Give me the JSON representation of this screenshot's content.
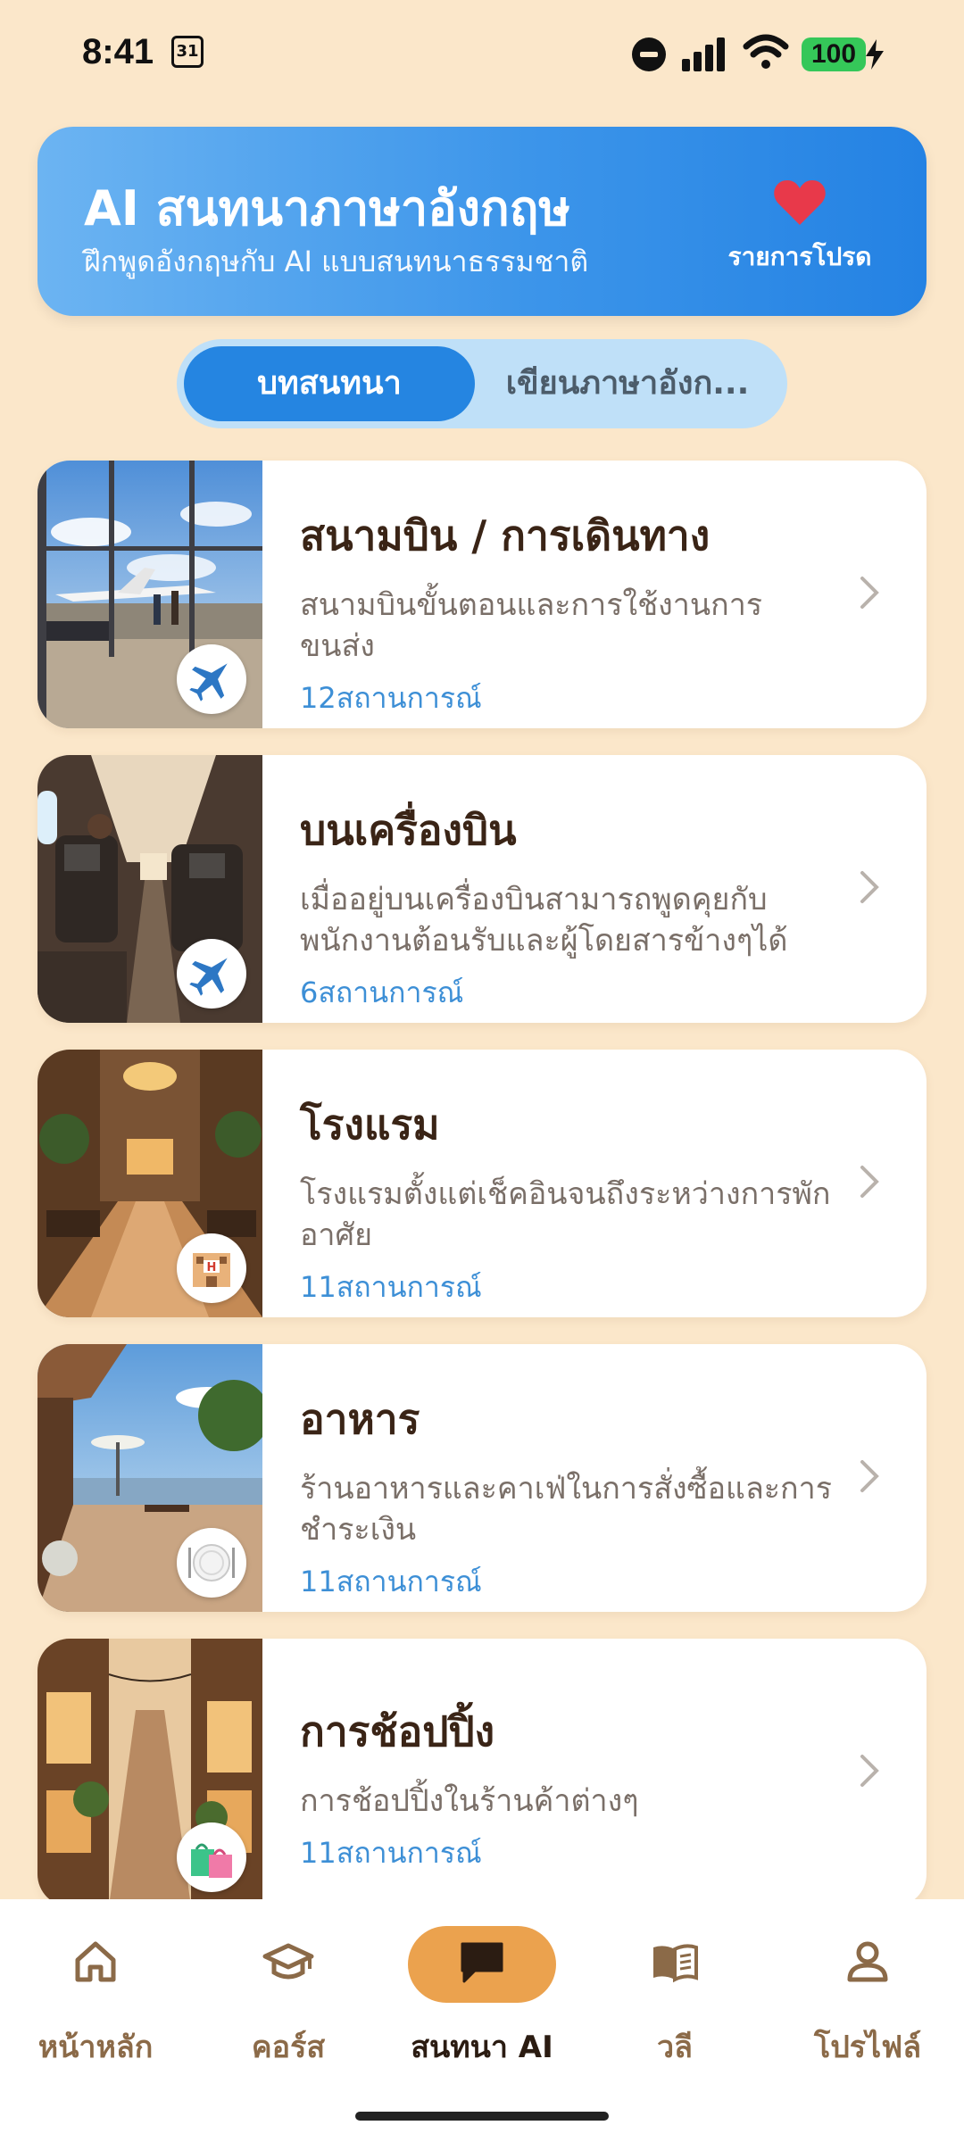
{
  "status_bar": {
    "time": "8:41",
    "calendar_day": "31",
    "battery": "100"
  },
  "header": {
    "title": "AI สนทนาภาษาอังกฤษ",
    "subtitle": "ฝึกพูดอังกฤษกับ AI แบบสนทนาธรรมชาติ",
    "favorites_label": "รายการโปรด"
  },
  "tabs": [
    {
      "label": "บทสนทนา",
      "active": true
    },
    {
      "label": "เขียนภาษาอังก...",
      "active": false
    }
  ],
  "categories": [
    {
      "title": "สนามบิน / การเดินทาง",
      "description": "สนามบินขั้นตอนและการใช้งานการขนส่ง",
      "count": "12สถานการณ์",
      "icon": "airplane-icon"
    },
    {
      "title": "บนเครื่องบิน",
      "description": "เมื่ออยู่บนเครื่องบินสามารถพูดคุยกับพนักงานต้อนรับและผู้โดยสารข้างๆได้",
      "count": "6สถานการณ์",
      "icon": "airplane-icon"
    },
    {
      "title": "โรงแรม",
      "description": "โรงแรมตั้งแต่เช็คอินจนถึงระหว่างการพักอาศัย",
      "count": "11สถานการณ์",
      "icon": "hotel-icon"
    },
    {
      "title": "อาหาร",
      "description": "ร้านอาหารและคาเฟ่ในการสั่งซื้อและการชำระเงิน",
      "count": "11สถานการณ์",
      "icon": "plate-icon"
    },
    {
      "title": "การช้อปปิ้ง",
      "description": "การช้อปปิ้งในร้านค้าต่างๆ",
      "count": "11สถานการณ์",
      "icon": "shopping-bags-icon"
    }
  ],
  "bottom_nav": [
    {
      "label": "หน้าหลัก",
      "icon": "home-icon",
      "active": false
    },
    {
      "label": "คอร์ส",
      "icon": "graduation-cap-icon",
      "active": false
    },
    {
      "label": "สนทนา AI",
      "icon": "chat-icon",
      "active": true
    },
    {
      "label": "วลี",
      "icon": "book-icon",
      "active": false
    },
    {
      "label": "โปรไฟล์",
      "icon": "person-icon",
      "active": false
    }
  ],
  "colors": {
    "background": "#FBE7CA",
    "header_start": "#6CB4F2",
    "header_end": "#2482E3",
    "accent_count": "#3D8FD6",
    "nav_active_pill": "#EBA24E",
    "heart": "#E8394A"
  }
}
